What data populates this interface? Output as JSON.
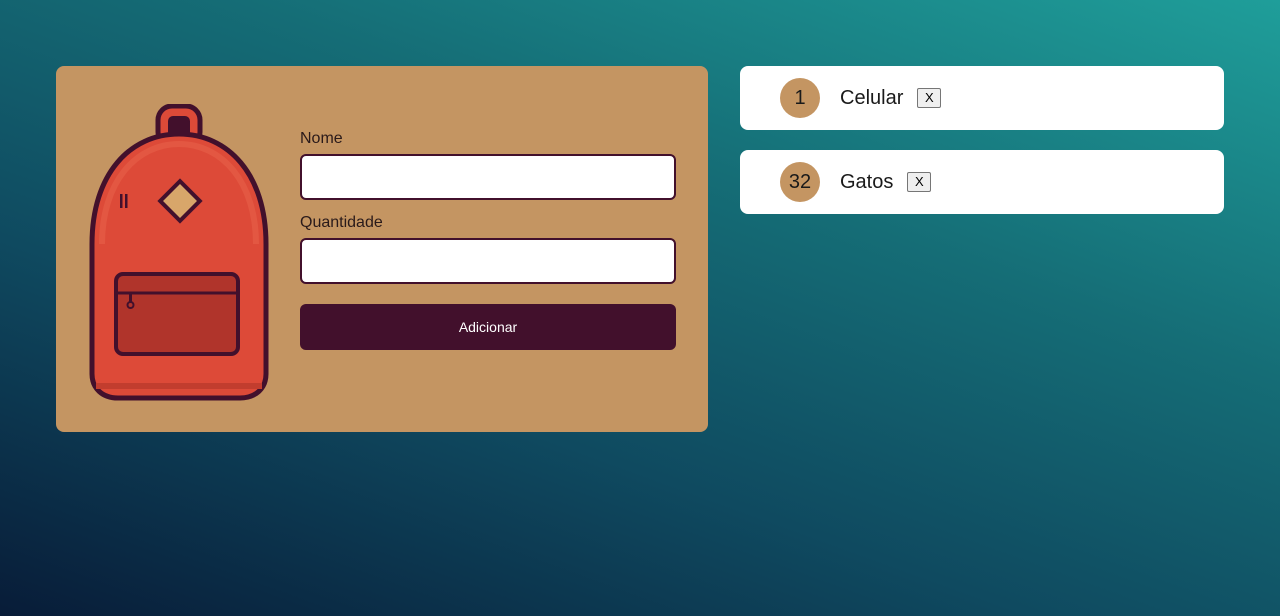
{
  "form": {
    "name_label": "Nome",
    "name_value": "",
    "quantity_label": "Quantidade",
    "quantity_value": "",
    "submit_label": "Adicionar"
  },
  "items": [
    {
      "quantity": "1",
      "name": "Celular",
      "remove_label": "X"
    },
    {
      "quantity": "32",
      "name": "Gatos",
      "remove_label": "X"
    }
  ],
  "colors": {
    "card_background": "#c49562",
    "accent_dark": "#42102c",
    "backpack_red": "#dd4a38",
    "background_top": "#1f9e9a",
    "background_bottom": "#081c38"
  },
  "icons": {
    "illustration": "backpack-icon"
  }
}
